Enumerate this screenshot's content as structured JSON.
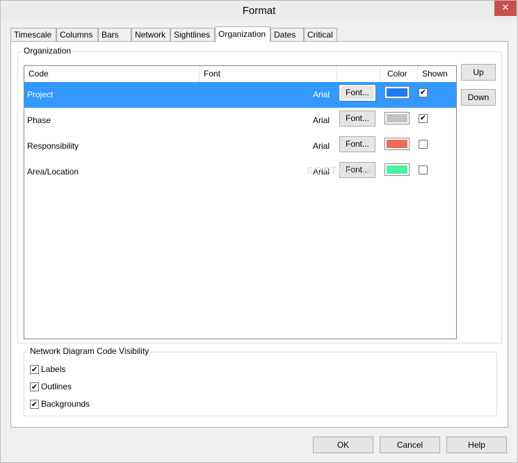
{
  "window": {
    "title": "Format"
  },
  "tabs": [
    {
      "label": "Timescale"
    },
    {
      "label": "Columns"
    },
    {
      "label": "Bars"
    },
    {
      "label": "Network"
    },
    {
      "label": "Sightlines"
    },
    {
      "label": "Organization",
      "active": true
    },
    {
      "label": "Dates"
    },
    {
      "label": "Critical"
    }
  ],
  "organization": {
    "group_label": "Organization",
    "columns": {
      "code": "Code",
      "font": "Font",
      "color": "Color",
      "shown": "Shown"
    },
    "rows": [
      {
        "code": "Project",
        "font": "Arial",
        "font_button": "Font...",
        "color": "#1e7bf0",
        "shown": true,
        "selected": true
      },
      {
        "code": "Phase",
        "font": "Arial",
        "font_button": "Font...",
        "color": "#c4c4c4",
        "shown": true,
        "selected": false
      },
      {
        "code": "Responsibility",
        "font": "Arial",
        "font_button": "Font...",
        "color": "#f06a5a",
        "shown": false,
        "selected": false
      },
      {
        "code": "Area/Location",
        "font": "Arial",
        "font_button": "Font...",
        "color": "#4cf0a0",
        "shown": false,
        "selected": false
      }
    ],
    "up_label": "Up",
    "down_label": "Down"
  },
  "visibility": {
    "group_label": "Network Diagram Code Visibility",
    "items": [
      {
        "label": "Labels",
        "checked": true
      },
      {
        "label": "Outlines",
        "checked": true
      },
      {
        "label": "Backgrounds",
        "checked": true
      }
    ]
  },
  "buttons": {
    "ok": "OK",
    "cancel": "Cancel",
    "help": "Help"
  },
  "close_glyph": "✕",
  "watermark": "SOFTPEDIA",
  "colors": {
    "selection": "#3399ff",
    "close": "#c75050"
  }
}
